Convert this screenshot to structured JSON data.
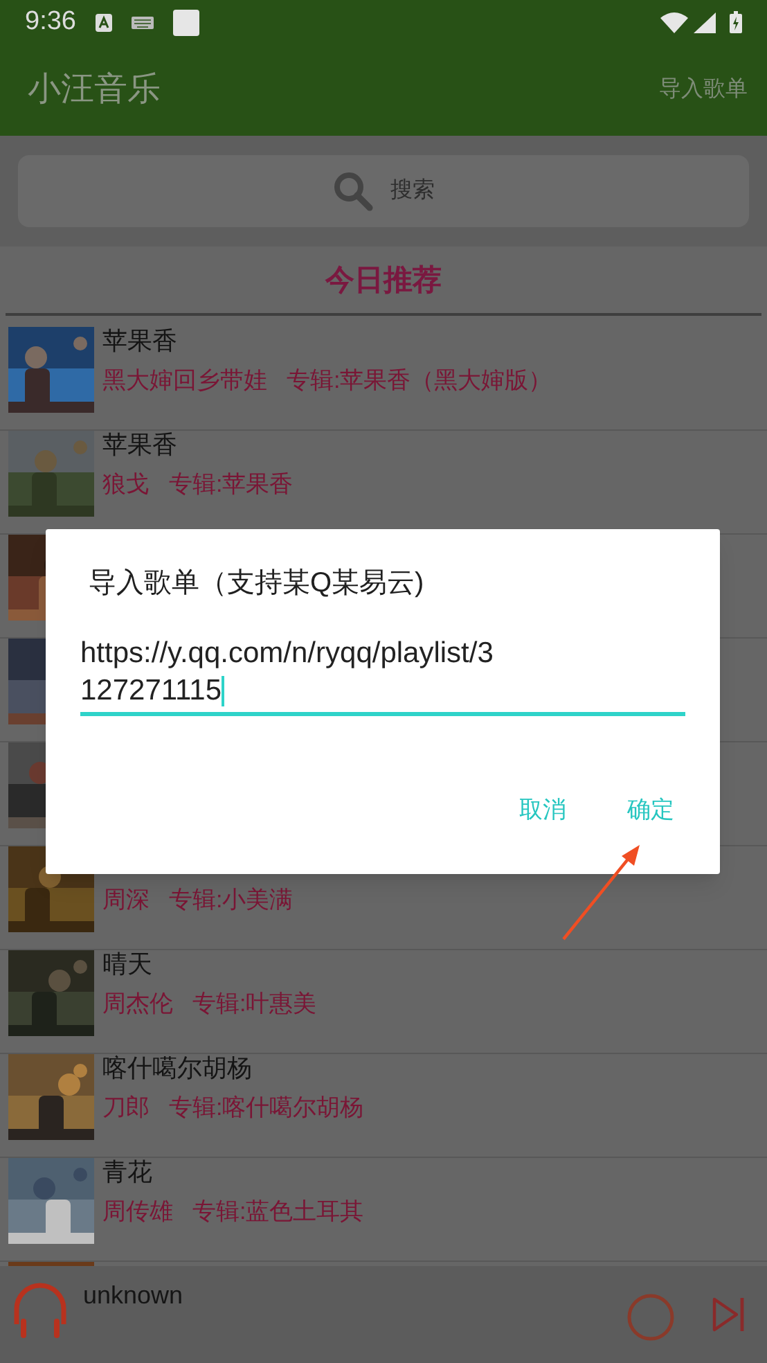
{
  "status_bar": {
    "time": "9:36"
  },
  "app_bar": {
    "title": "小汪音乐",
    "action": "导入歌单"
  },
  "search": {
    "placeholder": "搜索"
  },
  "section_title": "今日推荐",
  "songs": [
    {
      "kind": "song",
      "title": "苹果香",
      "artist": "黑大婶回乡带娃",
      "album": "专辑:苹果香（黑大婶版）"
    },
    {
      "kind": "song",
      "title": "苹果香",
      "artist": "狼戈",
      "album": "专辑:苹果香"
    },
    {
      "kind": "cover_only"
    },
    {
      "kind": "cover_only"
    },
    {
      "kind": "cover_only"
    },
    {
      "kind": "song",
      "artist": "周深",
      "album": "专辑:小美满"
    },
    {
      "kind": "song",
      "title": "晴天",
      "artist": "周杰伦",
      "album": "专辑:叶惠美"
    },
    {
      "kind": "song",
      "title": "喀什噶尔胡杨",
      "artist": "刀郎",
      "album": "专辑:喀什噶尔胡杨"
    },
    {
      "kind": "song",
      "title": "青花",
      "artist": "周传雄",
      "album": "专辑:蓝色土耳其"
    },
    {
      "kind": "cover_only"
    }
  ],
  "dialog": {
    "title": "导入歌单（支持某Q某易云)",
    "value": "https://y.qq.com/n/ryqq/playlist/3127271115",
    "buttons": [
      "取消",
      "确定"
    ]
  },
  "player": {
    "track": "unknown"
  }
}
